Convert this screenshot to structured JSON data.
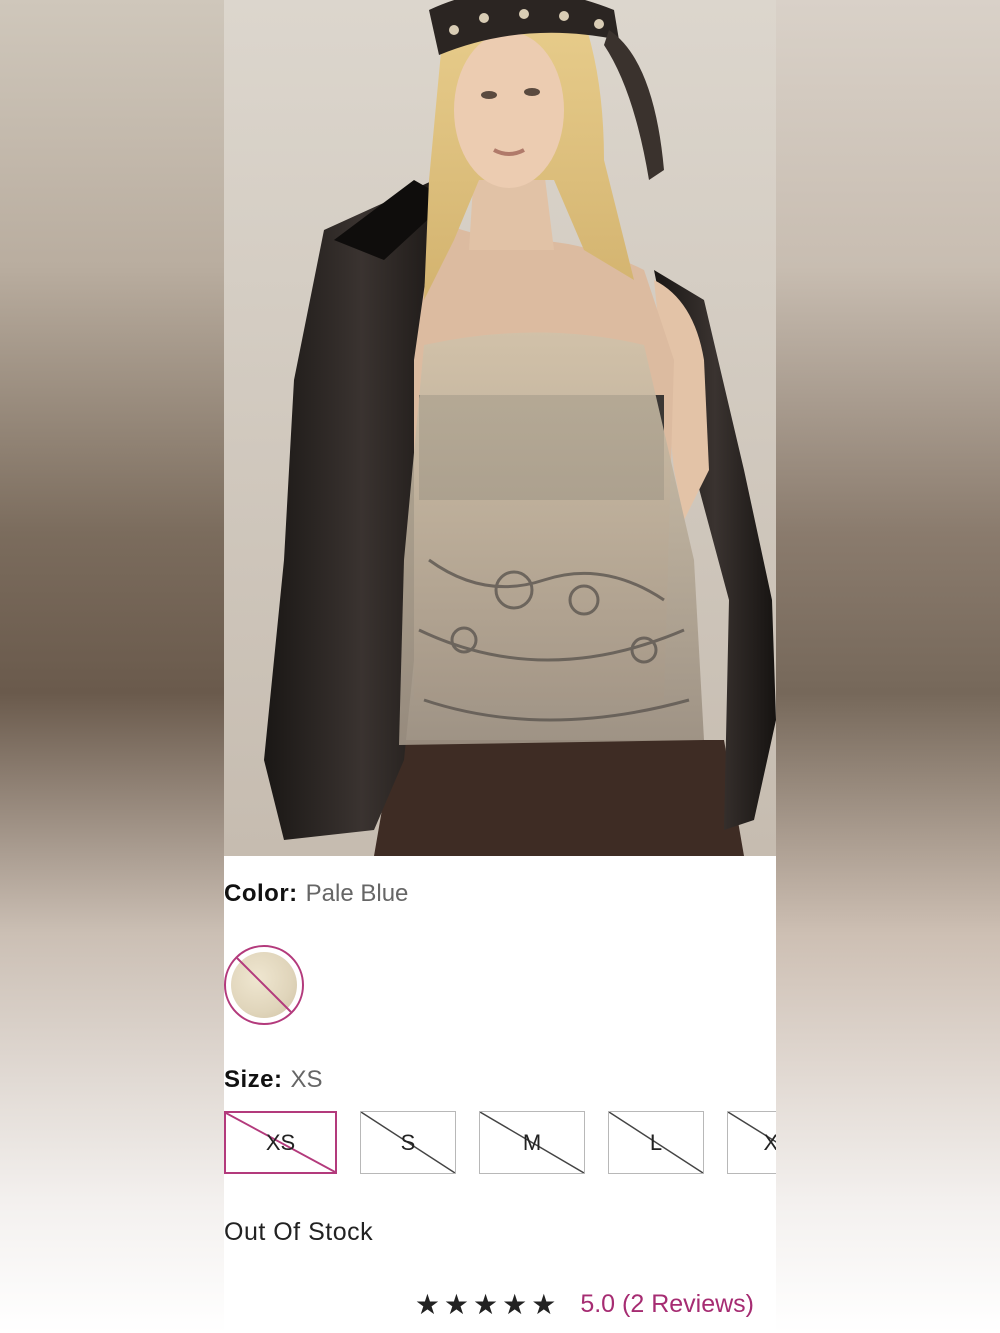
{
  "product": {
    "image_alt": "Model wearing sheer embellished halter top with black leather jacket"
  },
  "color": {
    "label": "Color:",
    "value": "Pale Blue",
    "swatch_color": "#e5dac1",
    "swatch_available": false
  },
  "size": {
    "label": "Size:",
    "value": "XS",
    "options": [
      {
        "label": "XS",
        "selected": true,
        "available": false
      },
      {
        "label": "S",
        "selected": false,
        "available": false
      },
      {
        "label": "M",
        "selected": false,
        "available": false
      },
      {
        "label": "L",
        "selected": false,
        "available": false
      },
      {
        "label": "XL",
        "selected": false,
        "available": false
      }
    ]
  },
  "stock_status": "Out Of Stock",
  "rating": {
    "stars": "★★★★★",
    "score": "5.0",
    "text": "5.0 (2 Reviews)"
  },
  "colors": {
    "accent": "#b33a7c",
    "rating_text": "#a62c72",
    "border": "#b8b8b8"
  }
}
